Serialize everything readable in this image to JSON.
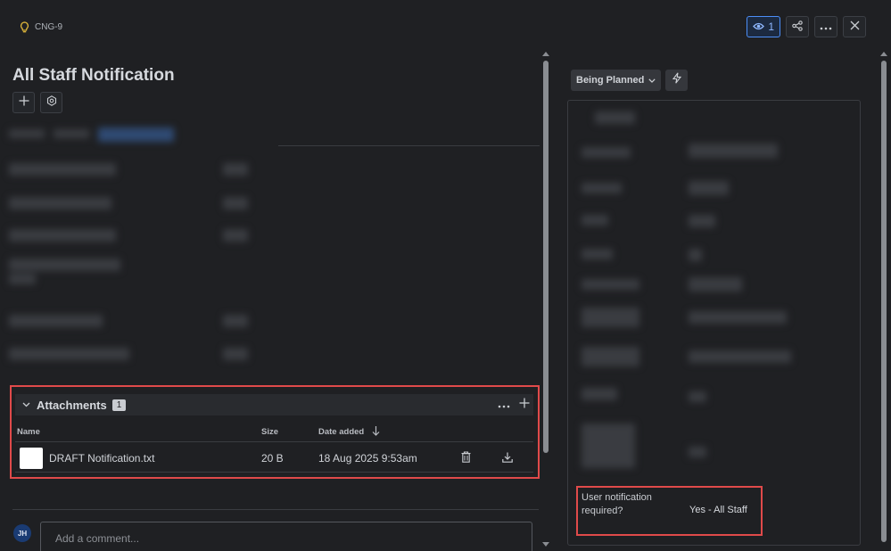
{
  "header": {
    "issue_key": "CNG-9",
    "watch_count": "1"
  },
  "issue": {
    "title": "All Staff Notification",
    "status": "Being Planned"
  },
  "attachments": {
    "title": "Attachments",
    "count": "1",
    "columns": {
      "name": "Name",
      "size": "Size",
      "date_added": "Date added"
    },
    "rows": [
      {
        "name": "DRAFT Notification.txt",
        "size": "20 B",
        "date_added": "18 Aug 2025 9:53am"
      }
    ]
  },
  "comment": {
    "avatar_initials": "JH",
    "placeholder": "Add a comment..."
  },
  "details": {
    "user_notification_label": "User notification required?",
    "user_notification_value": "Yes - All Staff"
  },
  "colors": {
    "background": "#1f2023",
    "highlight": "#e04a4a",
    "accent": "#4c8ef7"
  }
}
